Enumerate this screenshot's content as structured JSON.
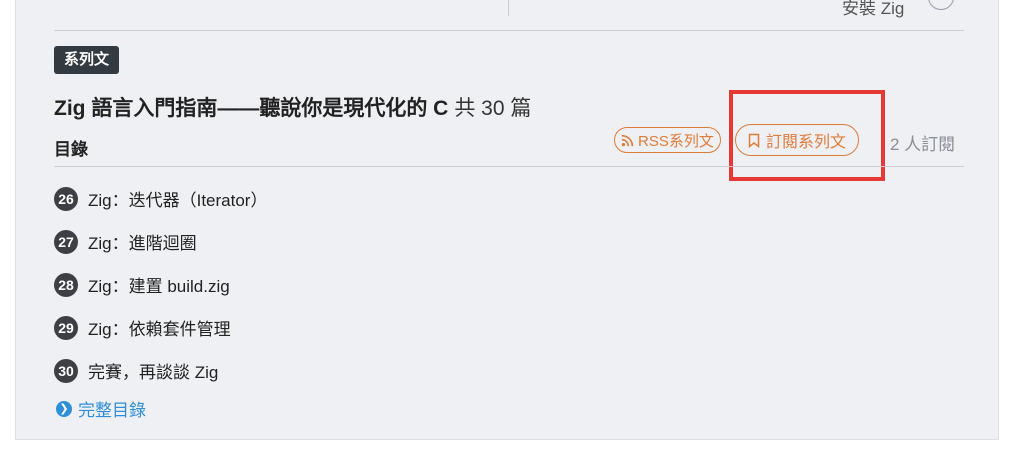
{
  "top": {
    "prev_title": "安裝 Zig"
  },
  "series": {
    "tag": "系列文",
    "title": "Zig 語言入門指南——聽說你是現代化的 C",
    "count": "共 30 篇",
    "toc_label": "目錄",
    "rss_label": "RSS系列文",
    "subscribe_label": "訂閱系列文",
    "subscriber_count": "2 人訂閱",
    "full_toc_label": "完整目錄"
  },
  "articles": [
    {
      "num": "26",
      "title": "Zig：迭代器（Iterator）"
    },
    {
      "num": "27",
      "title": "Zig：進階迴圈"
    },
    {
      "num": "28",
      "title": "Zig：建置 build.zig"
    },
    {
      "num": "29",
      "title": "Zig：依賴套件管理"
    },
    {
      "num": "30",
      "title": "完賽，再談談 Zig"
    }
  ],
  "colors": {
    "accent": "#e07b39",
    "link": "#2e8fd6",
    "highlight": "#e53935",
    "tag_bg": "#333a40"
  },
  "icons": {
    "rss": "rss-icon",
    "bookmark": "bookmark-icon",
    "chevron": "chevron-right-circle-icon"
  }
}
